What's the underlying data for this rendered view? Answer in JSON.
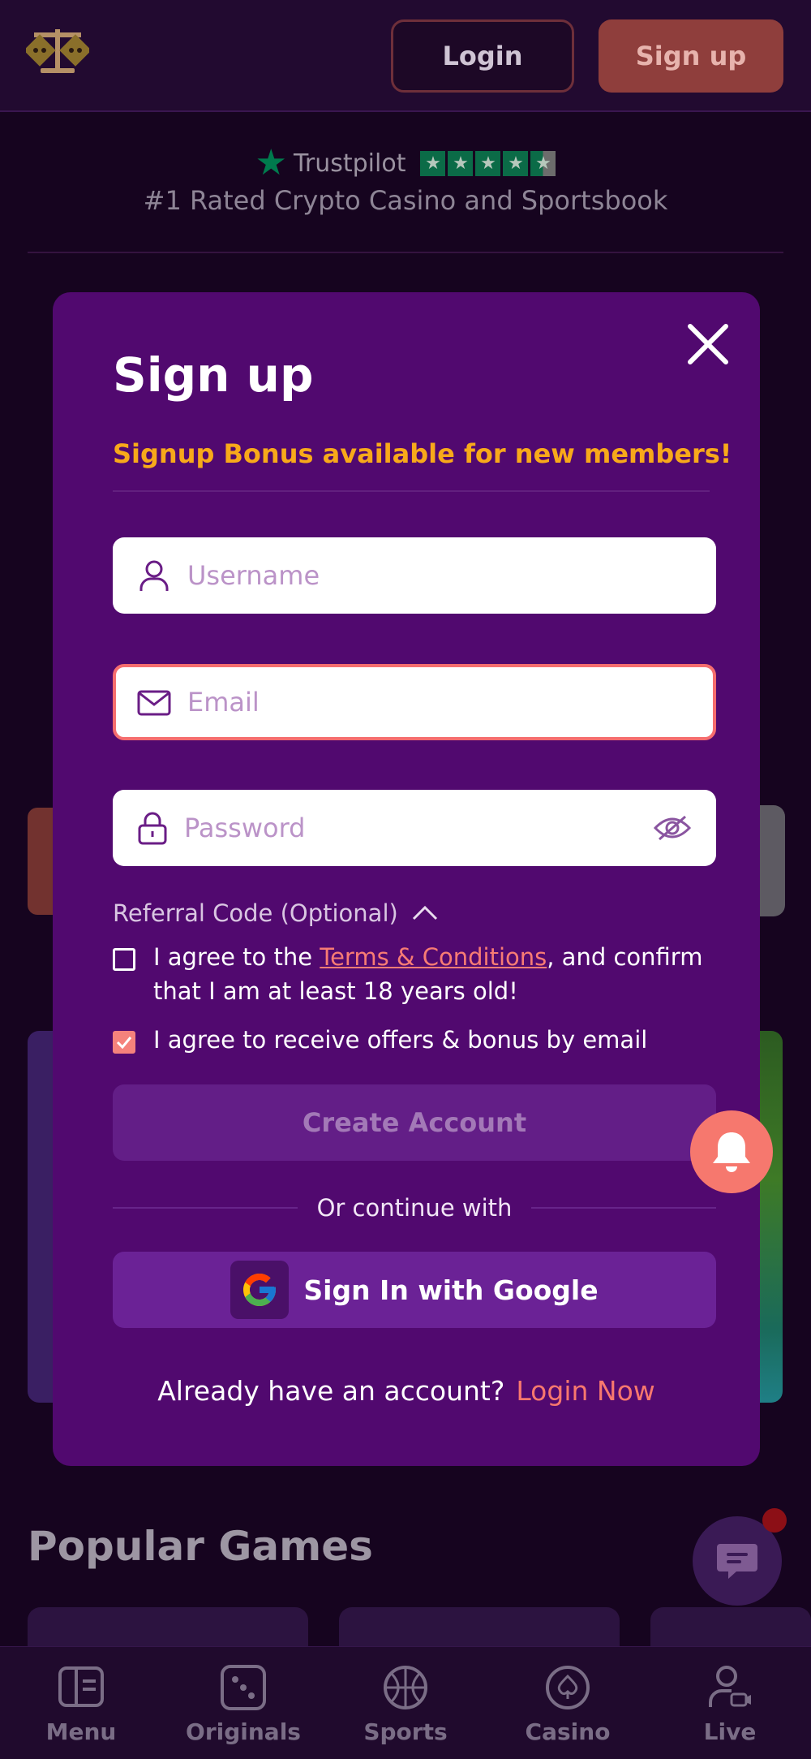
{
  "header": {
    "login_label": "Login",
    "signup_label": "Sign up"
  },
  "trust": {
    "brand": "Trustpilot",
    "tagline": "#1 Rated Crypto Casino and Sportsbook"
  },
  "modal": {
    "title": "Sign up",
    "bonus_text": "Signup Bonus available for new members!",
    "username_placeholder": "Username",
    "email_placeholder": "Email",
    "password_placeholder": "Password",
    "referral_label": "Referral Code (Optional)",
    "terms_prefix": "I agree to the ",
    "terms_link": "Terms & Conditions",
    "terms_suffix": ", and confirm that I am at least 18 years old!",
    "offers_label": "I agree to receive offers & bonus by email",
    "create_label": "Create Account",
    "or_label": "Or continue with",
    "google_label": "Sign In with Google",
    "already_text": "Already have an account?",
    "login_now": "Login Now"
  },
  "page": {
    "popular_title": "Popular Games"
  },
  "nav": {
    "items": [
      {
        "label": "Menu",
        "icon": "menu-icon"
      },
      {
        "label": "Originals",
        "icon": "dice-icon"
      },
      {
        "label": "Sports",
        "icon": "basketball-icon"
      },
      {
        "label": "Casino",
        "icon": "spade-chip-icon"
      },
      {
        "label": "Live",
        "icon": "live-user-icon"
      }
    ]
  },
  "colors": {
    "modal_bg": "#51096f",
    "accent": "#f6786e",
    "bonus": "#f8a91a"
  }
}
